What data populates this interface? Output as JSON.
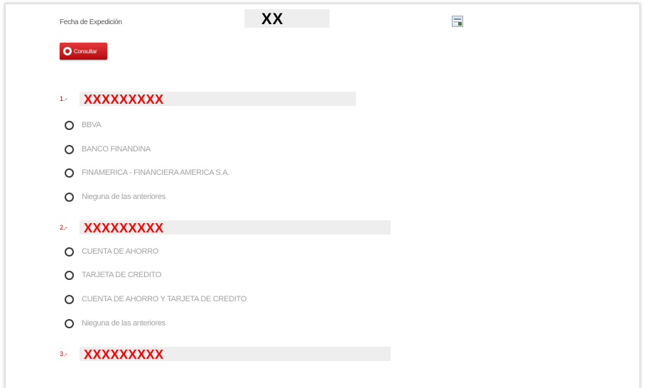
{
  "form": {
    "field_label": "Fecha de Expedición",
    "field_value": "XX",
    "calendar_icon": "calendar-icon",
    "consult_button": {
      "label": "Consultar",
      "icon": "hand-icon"
    }
  },
  "questions": [
    {
      "number": "1.-",
      "text": "XXXXXXXXX",
      "options": [
        "BBVA",
        "BANCO FINANDINA",
        "FINAMERICA - FINANCIERA AMERICA S.A.",
        "Nieguna de las anteriores"
      ]
    },
    {
      "number": "2.-",
      "text": "XXXXXXXXX",
      "options": [
        "CUENTA DE AHORRO",
        "TARJETA DE CREDITO",
        "CUENTA DE AHORRO Y TARJETA DE CREDITO",
        "Nieguna de las anteriores"
      ]
    },
    {
      "number": "3.-",
      "text": "XXXXXXXXX",
      "options": []
    }
  ],
  "colors": {
    "accent_red": "#ff0000",
    "button_red": "#c51d20",
    "option_text": "#a3a3a3"
  }
}
